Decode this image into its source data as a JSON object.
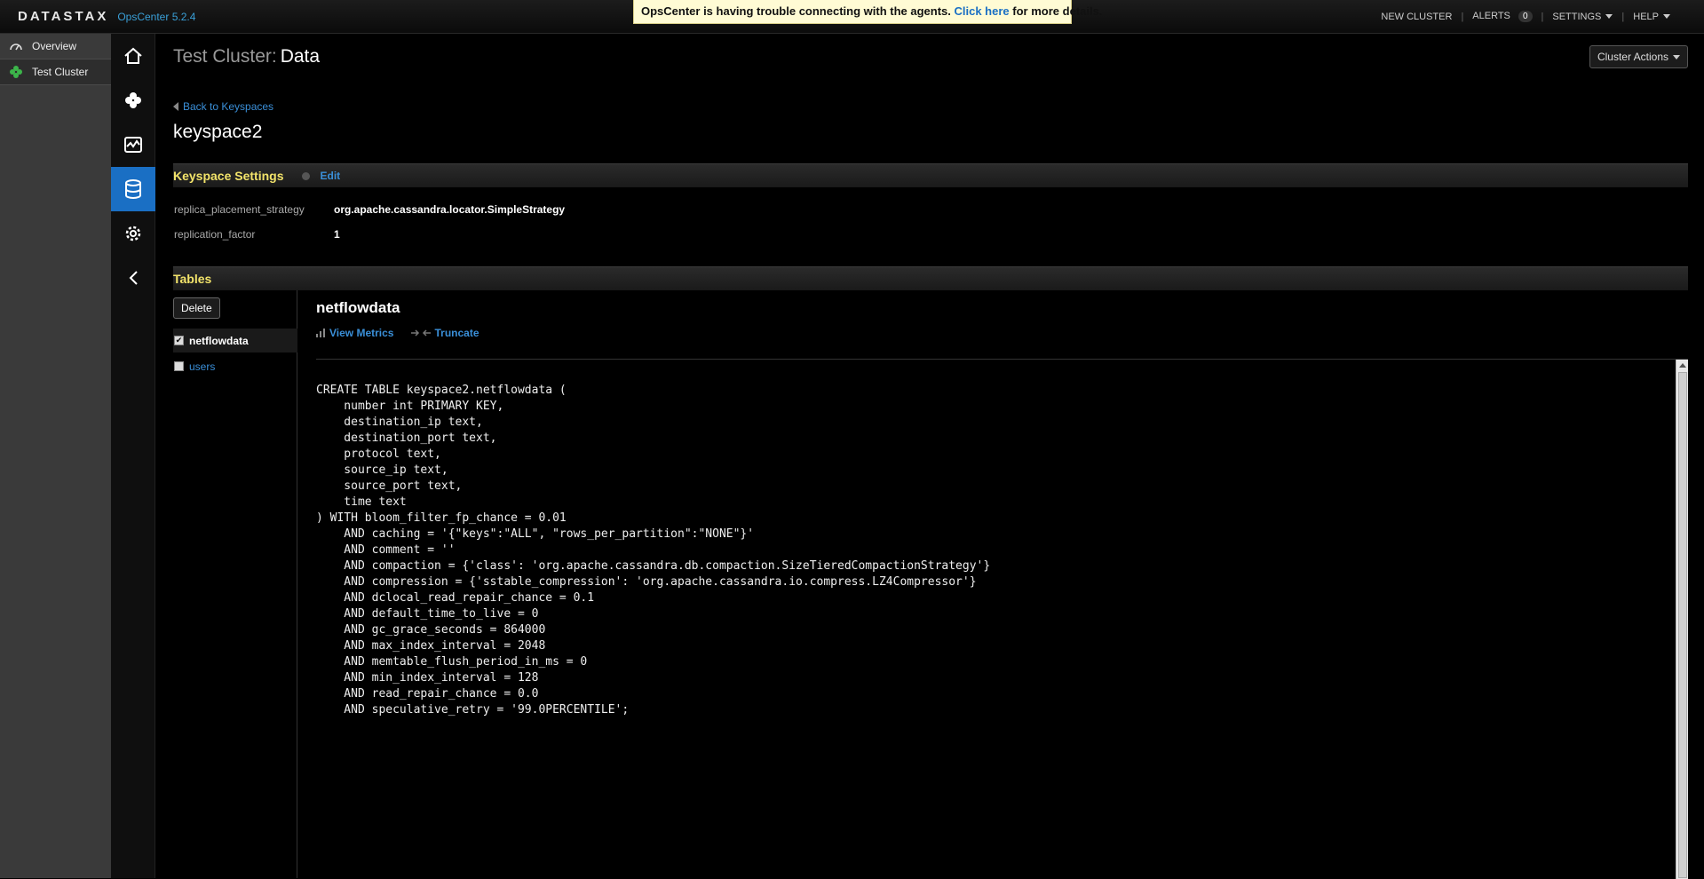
{
  "header": {
    "brand": "DATASTAX",
    "product": "OpsCenter 5.2.4",
    "notice_text": "OpsCenter is having trouble connecting with the agents.",
    "notice_link": "Click here",
    "notice_suffix": "for more details.",
    "nav": {
      "new_cluster": "NEW CLUSTER",
      "alerts": "ALERTS",
      "alerts_count": "0",
      "settings": "SETTINGS",
      "help": "HELP"
    }
  },
  "sidebar": {
    "items": [
      {
        "label": "Overview",
        "icon": "gauge-icon"
      },
      {
        "label": "Test Cluster",
        "icon": "cluster-icon"
      }
    ]
  },
  "rail": {
    "items": [
      "home-icon",
      "nodes-icon",
      "monitor-icon",
      "database-icon",
      "gear-icon",
      "collapse-icon"
    ],
    "active": "database-icon"
  },
  "page": {
    "cluster": "Test Cluster:",
    "section": "Data",
    "cluster_actions": "Cluster Actions",
    "back_link": "Back to Keyspaces",
    "keyspace": "keyspace2"
  },
  "keyspace_settings": {
    "title": "Keyspace Settings",
    "edit": "Edit",
    "rows": [
      {
        "key": "replica_placement_strategy",
        "value": "org.apache.cassandra.locator.SimpleStrategy"
      },
      {
        "key": "replication_factor",
        "value": "1"
      }
    ]
  },
  "tables": {
    "title": "Tables",
    "delete": "Delete",
    "list": [
      {
        "name": "netflowdata",
        "checked": true
      },
      {
        "name": "users",
        "checked": false
      }
    ],
    "selected": {
      "name": "netflowdata",
      "view_metrics": "View Metrics",
      "truncate": "Truncate",
      "ddl": "CREATE TABLE keyspace2.netflowdata (\n    number int PRIMARY KEY,\n    destination_ip text,\n    destination_port text,\n    protocol text,\n    source_ip text,\n    source_port text,\n    time text\n) WITH bloom_filter_fp_chance = 0.01\n    AND caching = '{\"keys\":\"ALL\", \"rows_per_partition\":\"NONE\"}'\n    AND comment = ''\n    AND compaction = {'class': 'org.apache.cassandra.db.compaction.SizeTieredCompactionStrategy'}\n    AND compression = {'sstable_compression': 'org.apache.cassandra.io.compress.LZ4Compressor'}\n    AND dclocal_read_repair_chance = 0.1\n    AND default_time_to_live = 0\n    AND gc_grace_seconds = 864000\n    AND max_index_interval = 2048\n    AND memtable_flush_period_in_ms = 0\n    AND min_index_interval = 128\n    AND read_repair_chance = 0.0\n    AND speculative_retry = '99.0PERCENTILE';"
    }
  },
  "colors": {
    "accent_blue": "#1a6fc4",
    "link_blue": "#3a8fd8",
    "section_title": "#f2e36a",
    "notice_bg": "#fffbd4"
  }
}
